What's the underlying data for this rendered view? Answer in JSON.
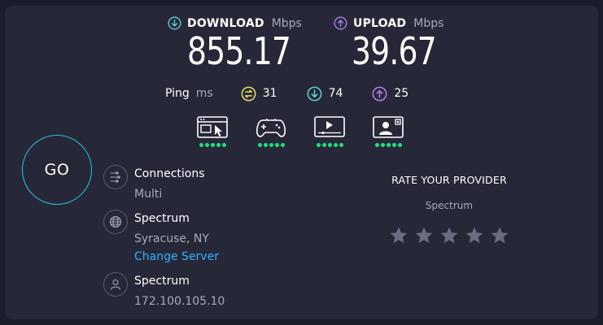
{
  "download": {
    "label": "DOWNLOAD",
    "unit": "Mbps",
    "value": "855.17"
  },
  "upload": {
    "label": "UPLOAD",
    "unit": "Mbps",
    "value": "39.67"
  },
  "ping": {
    "label": "Ping",
    "unit": "ms",
    "idle": "31",
    "download": "74",
    "upload": "25"
  },
  "apps": [
    {
      "icon": "browsing-icon",
      "rating": 5
    },
    {
      "icon": "gaming-icon",
      "rating": 5
    },
    {
      "icon": "video-streaming-icon",
      "rating": 5
    },
    {
      "icon": "video-chat-icon",
      "rating": 5
    }
  ],
  "go": {
    "label": "GO"
  },
  "connections": {
    "title": "Connections",
    "value": "Multi"
  },
  "isp": {
    "title": "Spectrum",
    "location": "Syracuse, NY",
    "change": "Change Server"
  },
  "client": {
    "title": "Spectrum",
    "ip": "172.100.105.10"
  },
  "rate": {
    "title": "RATE YOUR PROVIDER",
    "provider": "Spectrum",
    "stars": 5
  },
  "colors": {
    "background": "#1c1d2b",
    "panel": "#262838",
    "download_accent": "#5fd3d8",
    "upload_accent": "#b47fe8",
    "ping_accent": "#e8dc6a",
    "rating_dots": "#1fe07f",
    "go_ring": "#2ac5e0",
    "link": "#30b2ff"
  }
}
